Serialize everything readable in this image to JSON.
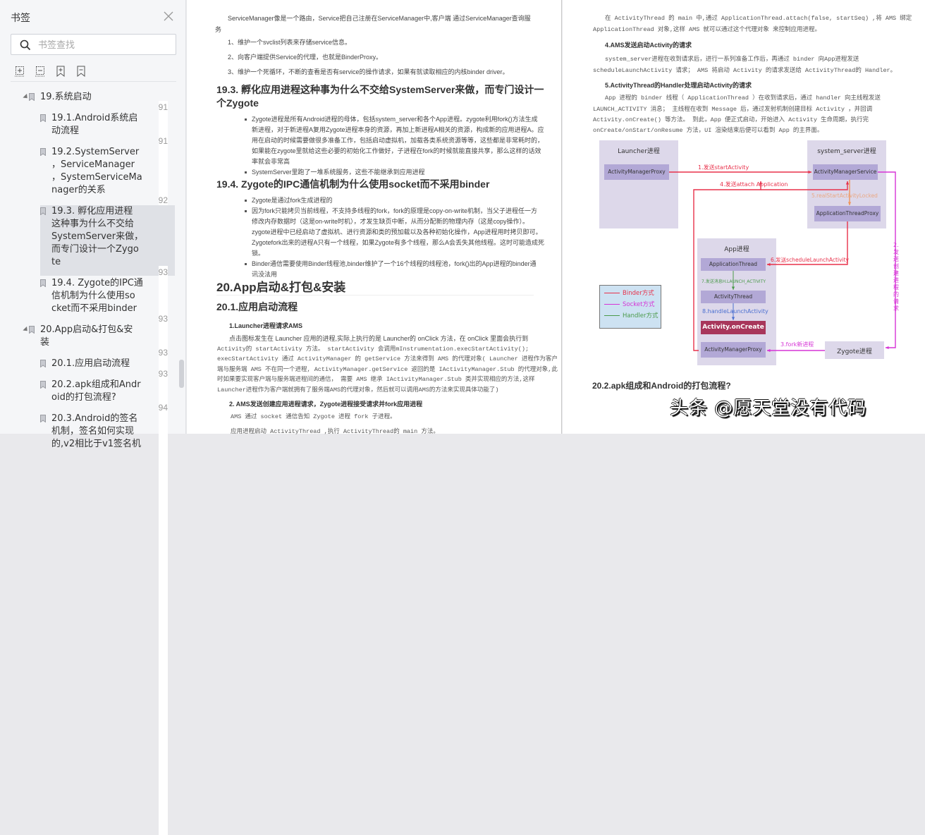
{
  "sidebar": {
    "title": "书签",
    "search_placeholder": "书签查找",
    "tools": [
      "expand-all-icon",
      "collapse-all-icon",
      "add-bookmark-icon",
      "remove-bookmark-icon"
    ],
    "items": [
      {
        "level": 0,
        "expanded": true,
        "label_lines": [
          "19.系统启动"
        ],
        "page": "91",
        "active": false
      },
      {
        "level": 1,
        "label_lines": [
          "19.1.Android系统启",
          "动流程"
        ],
        "page": "91",
        "active": false
      },
      {
        "level": 1,
        "label_lines": [
          "19.2.SystemServer",
          "，ServiceManager",
          "，SystemServiceMa",
          "nager的关系"
        ],
        "page": "92",
        "active": false
      },
      {
        "level": 1,
        "label_lines": [
          "19.3. 孵化应用进程",
          "这种事为什么不交给",
          "SystemServer来做，",
          "而专门设计一个Zygo",
          "te"
        ],
        "page": "93",
        "active": true
      },
      {
        "level": 1,
        "label_lines": [
          "19.4. Zygote的IPC通",
          "信机制为什么使用so",
          "cket而不采用binder"
        ],
        "page": "93",
        "active": false
      },
      {
        "level": 0,
        "expanded": true,
        "label_lines": [
          "20.App启动&打包&安",
          "装"
        ],
        "page": "93",
        "active": false
      },
      {
        "level": 1,
        "label_lines": [
          "20.1.应用启动流程"
        ],
        "page": "93",
        "active": false
      },
      {
        "level": 1,
        "label_lines": [
          "20.2.apk组成和Andr",
          "oid的打包流程?"
        ],
        "page": "94",
        "active": false
      },
      {
        "level": 1,
        "label_lines": [
          "20.3.Android的签名",
          "机制，签名如何实现",
          "的,v2相比于v1签名机"
        ],
        "page": "",
        "active": false
      }
    ]
  },
  "page1": {
    "intro": "ServiceManager像是一个路由，Service把自己注册在ServiceManager中,客户端 通过ServiceManager查询服",
    "intro_cont": "务",
    "list": [
      "1、维护一个svclist列表来存储service信息。",
      "2、向客户端提供Service的代理，也就是BinderProxy。",
      "3、维护一个死循环，不断的查看是否有service的操作请求，如果有就读取相应的内核binder driver。"
    ],
    "h_19_3": [
      "19.3. 孵化应用进程这种事为什么不交给SystemServer来做，而专门设计一",
      "个Zygote"
    ],
    "bullets_19_3": [
      [
        "Zygote进程是所有Android进程的母体，包括system_server和各个App进程。zygote利用fork()方法生成",
        "新进程，对于新进程A复用Zygote进程本身的资源，再加上新进程A相关的资源，构成新的应用进程A。应",
        "用在启动的时候需要做很多准备工作，包括启动虚拟机，加载各类系统资源等等，这些都是非常耗时的，",
        "如果能在zygote里就给这些必要的初始化工作做好，子进程在fork的时候就能直接共享，那么这样的话效",
        "率就会非常高"
      ],
      [
        "SystemServer里跑了一堆系统服务，这些不能继承到应用进程"
      ]
    ],
    "h_19_4": "19.4. Zygote的IPC通信机制为什么使用socket而不采用binder",
    "bullets_19_4": [
      [
        "Zygote是通过fork生成进程的"
      ],
      [
        "因为fork只能拷贝当前线程，不支持多线程的fork，fork的原理是copy-on-write机制，当父子进程任一方",
        "修改内存数据时（这是on-write时机），才发生缺页中断，从而分配新的物理内存（这是copy操作）。",
        "zygote进程中已经启动了虚拟机、进行资源和类的预加载以及各种初始化操作，App进程用时拷贝即可。",
        "Zygotefork出来的进程A只有一个线程，如果Zygote有多个线程，那么A会丢失其他线程。这时可能造成死",
        "锁。"
      ],
      [
        "Binder通信需要使用Binder线程池,binder维护了一个16个线程的线程池，fork()出的App进程的binder通",
        "讯没法用"
      ]
    ],
    "h_20": "20.App启动&打包&安装",
    "h_20_1": "20.1.应用启动流程",
    "s1_title": "1.Launcher进程请求AMS",
    "s1_lines": [
      "点击图标发生在 Launcher 应用的进程,实际上执行的是 Launcher的 onClick 方法，在 onClick 里面会执行到",
      "Activity的 startActivity 方法。 startActivity 会调用mInstrumentation.execStartActivity();",
      "execStartActivity 通过 ActivityManager 的 getService 方法来得到 AMS 的代理对象( Launcher 进程作为客户",
      "端与服务端 AMS 不在同一个进程, ActivityManager.getService 返回的是 IActivityManager.Stub 的代理对象,此",
      "时如果要实现客户端与服务端进程间的通信， 需要 AMS 继承 IActivityManager.Stub 类并实现相应的方法,这样",
      "Launcher进程作为客户端就拥有了服务端AMS的代理对象，然后就可以调用AMS的方法来实现具体功能了)"
    ],
    "s2_title": "2. AMS发送创建应用进程请求，Zygote进程接受请求并fork应用进程",
    "s2_line": "AMS 通过 socket 通信告知 Zygote 进程 fork 子进程。",
    "s3_line": "应用进程启动 ActivityThread ,执行 ActivityThread的 main 方法。"
  },
  "page2": {
    "p1": [
      "在 ActivityThread 的 main 中,通过 ApplicationThread.attach(false, startSeq) ,将 AMS 绑定",
      "ApplicationThread 对象,这样 AMS 就可以通过这个代理对象 来控制应用进程。"
    ],
    "s4_title": "4.AMS发送启动Activity的请求",
    "s4_lines": [
      "system_server进程在收到请求后，进行一系列准备工作后，再通过 binder 向App进程发送",
      "scheduleLaunchActivity 请求； AMS 将启动 Activity 的请求发送给 ActivityThread的 Handler。"
    ],
    "s5_title": "5.ActivityThread的Handler处理启动Activity的请求",
    "s5_lines": [
      "App 进程的 binder 线程（ ApplicationThread ）在收到请求后，通过 handler 向主线程发送",
      "LAUNCH_ACTIVITY 消息； 主线程在收到 Message 后，通过发射机制创建目标 Activity ，并回调",
      "Activity.onCreate() 等方法。 到此，App 便正式启动，开始进入 Activity 生命周期，执行完",
      "onCreate/onStart/onResume 方法，UI 渲染结束后便可以看到 App 的主界面。"
    ],
    "h_20_2": "20.2.apk组成和Android的打包流程?"
  },
  "diagram": {
    "launcher_title": "Launcher进程",
    "launcher_box": "ActivityManagerProxy",
    "server_title": "system_server进程",
    "ams_box": "ActivityManagerService",
    "atp_box": "ApplicationThreadProxy",
    "app_title": "App进程",
    "app_thread_box": "ApplicationThread",
    "activity_thread_box": "ActivityThread",
    "oncreate_box": "Activity.onCreate",
    "app_amp_box": "ActivityManagerProxy",
    "zygote_box": "Zygote进程",
    "step1": "1.发送startActivity",
    "step2": "2.发送创建进程的请求",
    "step3": "3.fork新进程",
    "step4": "4.发送attach Application",
    "step5": "5.realStartActivityLocked",
    "step6": "6.发送scheduleLaunchActivity",
    "step7": "7.发送消息H.LAUNCH_ACTIVITY",
    "step8": "8.handleLaunchActivity",
    "legend": [
      {
        "label": "Binder方式",
        "color": "#e8304a"
      },
      {
        "label": "Socket方式",
        "color": "#d633d6"
      },
      {
        "label": "Handler方式",
        "color": "#4a9a4a"
      }
    ],
    "colors": {
      "binder": "#e8304a",
      "socket": "#d633d6",
      "handler": "#4a9a4a",
      "orange": "#f0955a",
      "blue": "#4a6fd0"
    }
  },
  "watermark": "头条 @愿天堂没有代码"
}
